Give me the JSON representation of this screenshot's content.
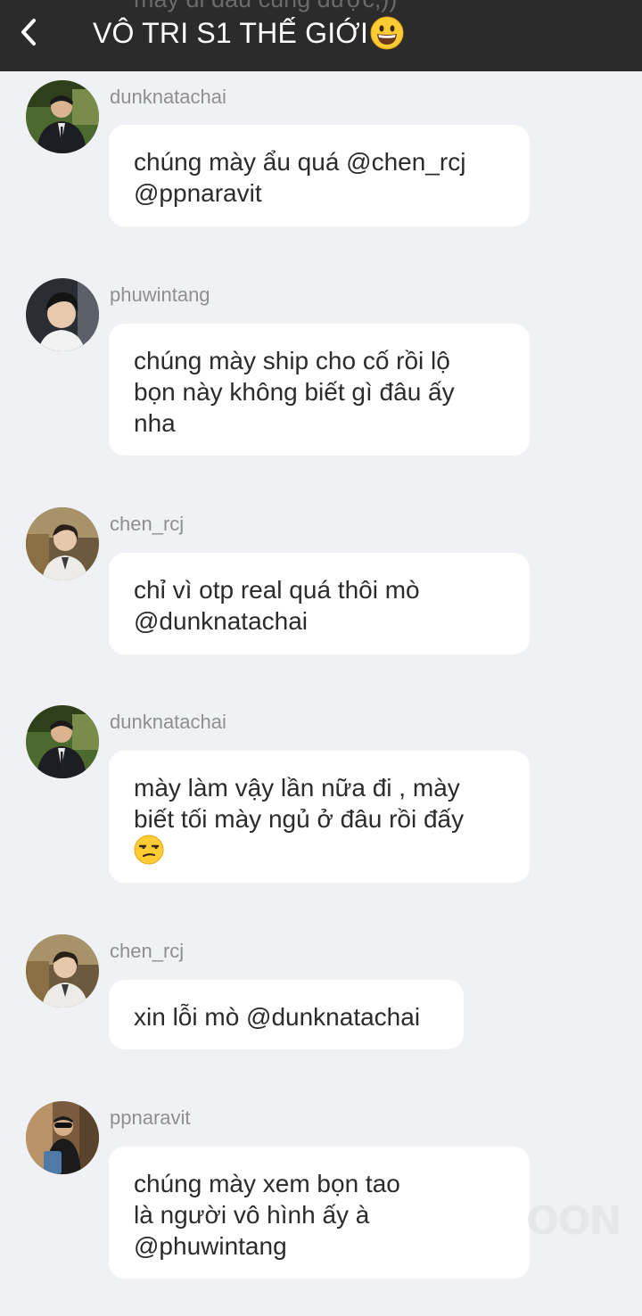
{
  "header": {
    "title": "VÔ TRI S1 THẾ GIỚI",
    "title_emoji": "grinning-face-emoji",
    "peek_text": "mày đi đâu cũng được;))"
  },
  "messages": [
    {
      "username": "dunknatachai",
      "avatar": "dunknatachai-avatar",
      "lines": [
        "chúng mày ẩu quá @chen_rcj",
        "@ppnaravit"
      ]
    },
    {
      "username": "phuwintang",
      "avatar": "phuwintang-avatar",
      "lines": [
        "chúng mày ship cho cố rồi lộ",
        "bọn này không biết gì đâu ấy",
        "nha"
      ]
    },
    {
      "username": "chen_rcj",
      "avatar": "chen_rcj-avatar",
      "lines": [
        "chỉ vì otp real quá thôi mò",
        "@dunknatachai"
      ]
    },
    {
      "username": "dunknatachai",
      "avatar": "dunknatachai-avatar",
      "lines": [
        "mày làm vậy lần nữa đi , mày",
        "biết tối mày ngủ ở đâu rồi đấy"
      ],
      "emoji": "unamused-face-emoji"
    },
    {
      "username": "chen_rcj",
      "avatar": "chen_rcj-avatar",
      "lines": [
        "xin lỗi mò @dunknatachai"
      ]
    },
    {
      "username": "ppnaravit",
      "avatar": "ppnaravit-avatar",
      "lines": [
        "chúng mày xem bọn tao",
        "là người vô hình ấy à",
        "@phuwintang"
      ]
    }
  ],
  "watermark": "OON",
  "colors": {
    "header_bg": "#2b2b2b",
    "page_bg": "#f0f1f4",
    "bubble_bg": "#ffffff",
    "username": "#8e8e93",
    "text": "#2b2b2b"
  }
}
